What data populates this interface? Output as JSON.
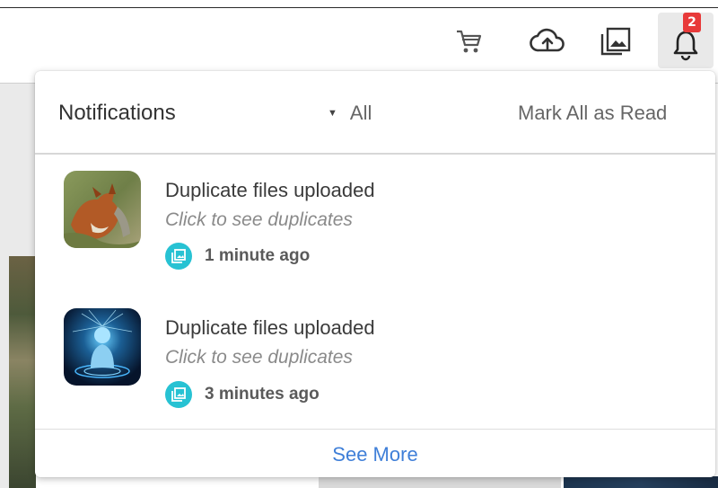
{
  "toolbar": {
    "icons": [
      "cart-icon",
      "upload-cloud-icon",
      "gallery-icon",
      "bell-icon"
    ],
    "notification_count": "2"
  },
  "notifications_panel": {
    "title": "Notifications",
    "filter_label": "All",
    "mark_all_label": "Mark All as Read",
    "items": [
      {
        "title": "Duplicate files uploaded",
        "subtitle": "Click to see duplicates",
        "time": "1 minute ago",
        "thumbnail": "fox-photo"
      },
      {
        "title": "Duplicate files uploaded",
        "subtitle": "Click to see duplicates",
        "time": "3 minutes ago",
        "thumbnail": "digital-figure-image"
      }
    ],
    "see_more_label": "See More"
  },
  "colors": {
    "badge": "#e83a3a",
    "meta_icon": "#27c2d3",
    "link": "#3f7fd8"
  }
}
